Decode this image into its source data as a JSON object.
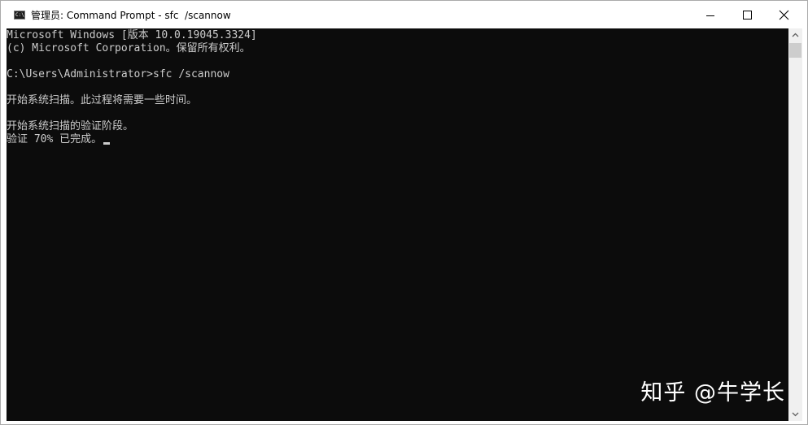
{
  "window": {
    "title": "管理员: Command Prompt - sfc  /scannow",
    "icon": "cmd-icon"
  },
  "controls": {
    "minimize_icon": "minimize-icon",
    "maximize_icon": "maximize-icon",
    "close_icon": "close-icon"
  },
  "console": {
    "lines": [
      "Microsoft Windows [版本 10.0.19045.3324]",
      "(c) Microsoft Corporation。保留所有权利。",
      "",
      "C:\\Users\\Administrator>sfc /scannow",
      "",
      "开始系统扫描。此过程将需要一些时间。",
      "",
      "开始系统扫描的验证阶段。",
      "验证 70% 已完成。"
    ],
    "progress_percent": 70,
    "background": "#0c0c0c",
    "foreground": "#cccccc"
  },
  "watermark": "知乎 @牛学长",
  "scrollbar": {
    "up_icon": "arrow-up-icon",
    "down_icon": "arrow-down-icon"
  }
}
